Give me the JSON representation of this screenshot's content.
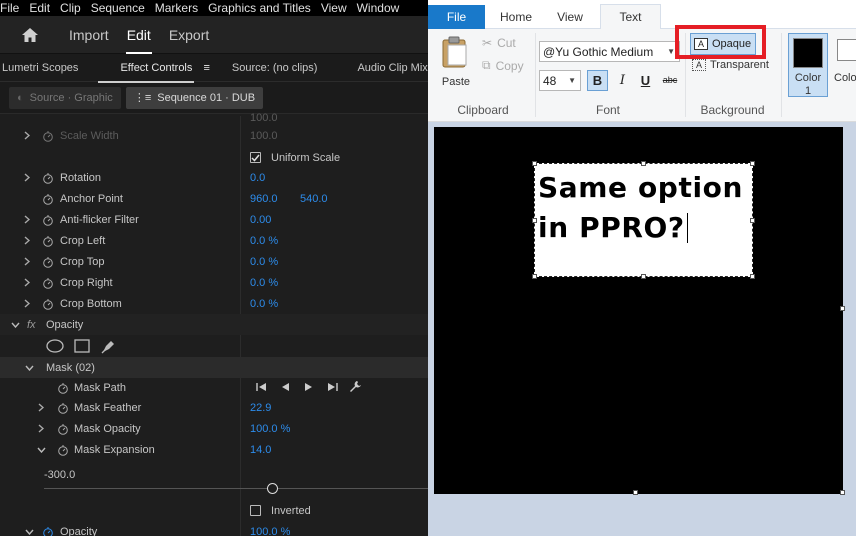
{
  "ppro": {
    "menu": [
      "File",
      "Edit",
      "Clip",
      "Sequence",
      "Markers",
      "Graphics and Titles",
      "View",
      "Window"
    ],
    "workspace": {
      "import": "Import",
      "edit": "Edit",
      "export": "Export"
    },
    "panels": [
      "Lumetri Scopes",
      "Effect Controls",
      "Source: (no clips)",
      "Audio Clip Mixer"
    ],
    "seq_source": "Source · Graphic",
    "seq_active": "Sequence 01 · DUB",
    "rows": {
      "top_val": "100.0",
      "scale_width": "Scale Width",
      "scale_width_val": "100.0",
      "uniform_scale": "Uniform Scale",
      "rotation": "Rotation",
      "rotation_val": "0.0",
      "anchor": "Anchor Point",
      "anchor_x": "960.0",
      "anchor_y": "540.0",
      "antiflicker": "Anti-flicker Filter",
      "antiflicker_val": "0.00",
      "crop_left": "Crop Left",
      "crop_left_val": "0.0 %",
      "crop_top": "Crop Top",
      "crop_top_val": "0.0 %",
      "crop_right": "Crop Right",
      "crop_right_val": "0.0 %",
      "crop_bottom": "Crop Bottom",
      "crop_bottom_val": "0.0 %",
      "fx": "fx",
      "opacity": "Opacity",
      "mask": "Mask (02)",
      "mask_path": "Mask Path",
      "mask_feather": "Mask Feather",
      "mask_feather_val": "22.9",
      "mask_opacity": "Mask Opacity",
      "mask_opacity_val": "100.0 %",
      "mask_expansion": "Mask Expansion",
      "mask_expansion_val": "14.0",
      "slider_min": "-300.0",
      "inverted": "Inverted",
      "opacity2": "Opacity",
      "opacity2_val": "100.0 %"
    }
  },
  "paint": {
    "tabs": {
      "file": "File",
      "home": "Home",
      "view": "View",
      "text": "Text"
    },
    "clipboard": {
      "paste": "Paste",
      "cut": "Cut",
      "copy": "Copy",
      "label": "Clipboard"
    },
    "font": {
      "family": "@Yu Gothic Medium",
      "size": "48",
      "label": "Font",
      "bold": "B",
      "italic": "I",
      "underline": "U",
      "strike": "abc"
    },
    "background": {
      "opaque": "Opaque",
      "transparent": "Transparent",
      "label": "Background"
    },
    "colors": {
      "color1": "Color",
      "color1_num": "1",
      "color2": "Colo"
    },
    "text_line1": "Same option",
    "text_line2": "in PPRO?",
    "highlight_color": "#e51e25"
  }
}
